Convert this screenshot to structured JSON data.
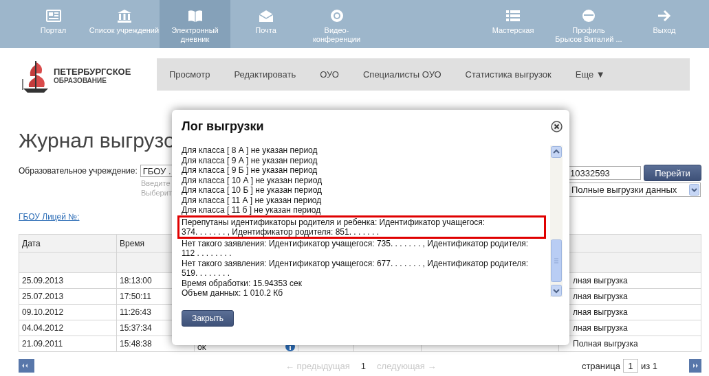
{
  "nav_left": [
    {
      "label": "Портал",
      "selected": false
    },
    {
      "label": "Список учреждений",
      "selected": false
    },
    {
      "label": "Электронный дневник",
      "selected": true
    },
    {
      "label": "Почта",
      "selected": false
    },
    {
      "label": "Видео-конференции",
      "selected": false
    }
  ],
  "nav_right": [
    {
      "label": "Мастерская",
      "selected": false
    },
    {
      "label": "Профиль",
      "sublabel": "Брысов Виталий ...",
      "selected": false
    },
    {
      "label": "Выход",
      "selected": false
    }
  ],
  "logo": {
    "line1": "ПЕТЕРБУРГСКОЕ",
    "line2": "ОБРАЗОВАНИЕ"
  },
  "menu": [
    "Просмотр",
    "Редактировать",
    "ОУО",
    "Специалисты ОУО",
    "Статистика выгрузок",
    "Еще ▼"
  ],
  "page_title": "Журнал выгрузо",
  "form": {
    "label": "Образовательное учреждение:",
    "school_value": "ГБОУ .",
    "hints": [
      "Введите",
      "Выберит"
    ],
    "code_value": "10332593",
    "go_button": "Перейти",
    "type_select": "Полные выгрузки данных"
  },
  "school_link": "ГБОУ Лицей №:",
  "table": {
    "columns": [
      "Дата",
      "Время"
    ],
    "rows": [
      {
        "date": "25.09.2013",
        "time": "18:13:00",
        "type": "лная выгрузка"
      },
      {
        "date": "25.07.2013",
        "time": "17:50:11",
        "type": "лная выгрузка"
      },
      {
        "date": "09.10.2012",
        "time": "11:26:43",
        "type": "лная выгрузка"
      },
      {
        "date": "04.04.2012",
        "time": "15:37:34",
        "type": "лная выгрузка"
      },
      {
        "date": "21.09.2011",
        "time": "15:48:38",
        "status": "ok",
        "type": "Полная выгрузка"
      }
    ]
  },
  "pagination": {
    "prev": "← предыдущая",
    "current": "1",
    "next": "следующая →",
    "page_label": "страница",
    "page_value": "1",
    "of": "из 1"
  },
  "dialog": {
    "title": "Лог выгрузки",
    "log": [
      {
        "text": "Для класса [ 8 А ] не указан период",
        "highlighted": false
      },
      {
        "text": "Для класса [ 9 А ] не указан период",
        "highlighted": false
      },
      {
        "text": "Для класса [ 9 Б ] не указан период",
        "highlighted": false
      },
      {
        "text": "Для класса [ 10 А ] не указан период",
        "highlighted": false
      },
      {
        "text": "Для класса [ 10 Б ] не указан период",
        "highlighted": false
      },
      {
        "text": "Для класса [ 11 А ] не указан период",
        "highlighted": false
      },
      {
        "text": "Для класса [ 11 б ] не указан период",
        "highlighted": false
      },
      {
        "lines": [
          "Перепутаны идентификаторы родителя и ребенка: Идентификатор учащегося:",
          "374. . . . . . . , Идентификатор родителя: 851. . . . . . ."
        ],
        "highlighted": true
      },
      {
        "lines": [
          "Нет такого заявления: Идентификатор учащегося: 735. . . . . . . , Идентификатор родителя:",
          "112 . . . . . . . ."
        ],
        "highlighted": false
      },
      {
        "lines": [
          "Нет такого заявления: Идентификатор учащегося: 677. . . . . . . , Идентификатор родителя:",
          "519. . . . . . . ."
        ],
        "highlighted": false
      },
      {
        "text": "Время обработки: 15.94353 сек",
        "highlighted": false
      },
      {
        "text": "Объем данных: 1 010.2 Кб",
        "highlighted": false
      }
    ],
    "close_button": "Закрыть"
  }
}
